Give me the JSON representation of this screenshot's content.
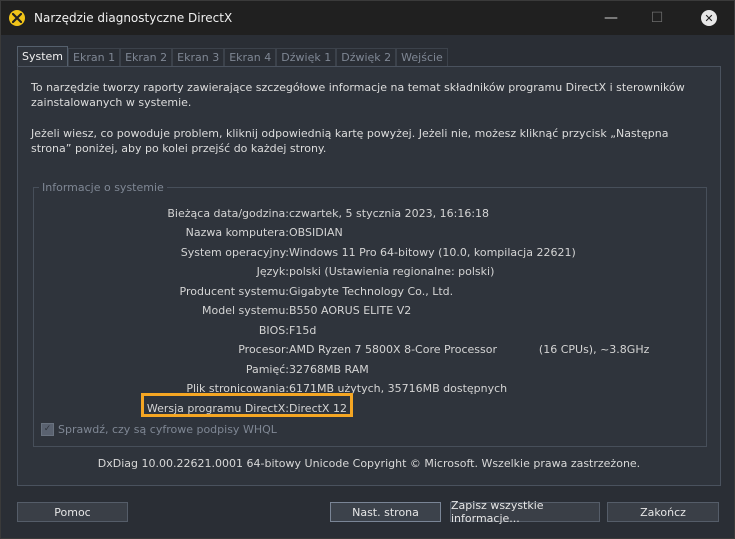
{
  "window": {
    "title": "Narzędzie diagnostyczne DirectX"
  },
  "tabs": [
    {
      "label": "System",
      "active": true
    },
    {
      "label": "Ekran 1"
    },
    {
      "label": "Ekran 2"
    },
    {
      "label": "Ekran 3"
    },
    {
      "label": "Ekran 4"
    },
    {
      "label": "Dźwięk 1"
    },
    {
      "label": "Dźwięk 2"
    },
    {
      "label": "Wejście"
    }
  ],
  "intro": {
    "p1": "To narzędzie tworzy raporty zawierające szczegółowe informacje na temat składników programu DirectX i sterowników zainstalowanych w systemie.",
    "p2": "Jeżeli wiesz, co powoduje problem, kliknij odpowiednią kartę powyżej. Jeżeli nie, możesz kliknąć przycisk „Następna strona” poniżej, aby po kolei przejść do każdej strony."
  },
  "system_info": {
    "title": "Informacje o systemie",
    "rows": [
      {
        "label": "Bieżąca data/godzina:",
        "value": "czwartek, 5 stycznia 2023, 16:16:18"
      },
      {
        "label": "Nazwa komputera:",
        "value": "OBSIDIAN"
      },
      {
        "label": "System operacyjny:",
        "value": "Windows 11 Pro 64-bitowy (10.0, kompilacja 22621)"
      },
      {
        "label": "Język:",
        "value": "polski (Ustawienia regionalne: polski)"
      },
      {
        "label": "Producent systemu:",
        "value": "Gigabyte Technology Co., Ltd."
      },
      {
        "label": "Model systemu:",
        "value": "B550 AORUS ELITE V2"
      },
      {
        "label": "BIOS:",
        "value": "F15d"
      },
      {
        "label": "Procesor:",
        "value": "AMD Ryzen 7 5800X 8-Core Processor            (16 CPUs), ~3.8GHz"
      },
      {
        "label": "Pamięć:",
        "value": "32768MB RAM"
      },
      {
        "label": "Plik stronicowania:",
        "value": "6171MB użytych, 35716MB dostępnych"
      },
      {
        "label": "Wersja programu DirectX:",
        "value": "DirectX 12"
      }
    ],
    "whql_label": "Sprawdź, czy są cyfrowe podpisy WHQL",
    "whql_checked": true
  },
  "copyright": "DxDiag 10.00.22621.0001 64-bitowy Unicode  Copyright © Microsoft. Wszelkie prawa zastrzeżone.",
  "buttons": {
    "help": "Pomoc",
    "next": "Nast. strona",
    "save": "Zapisz wszystkie informacje...",
    "exit": "Zakończ"
  },
  "colors": {
    "highlight": "#f5a623",
    "background": "#2f343c"
  }
}
